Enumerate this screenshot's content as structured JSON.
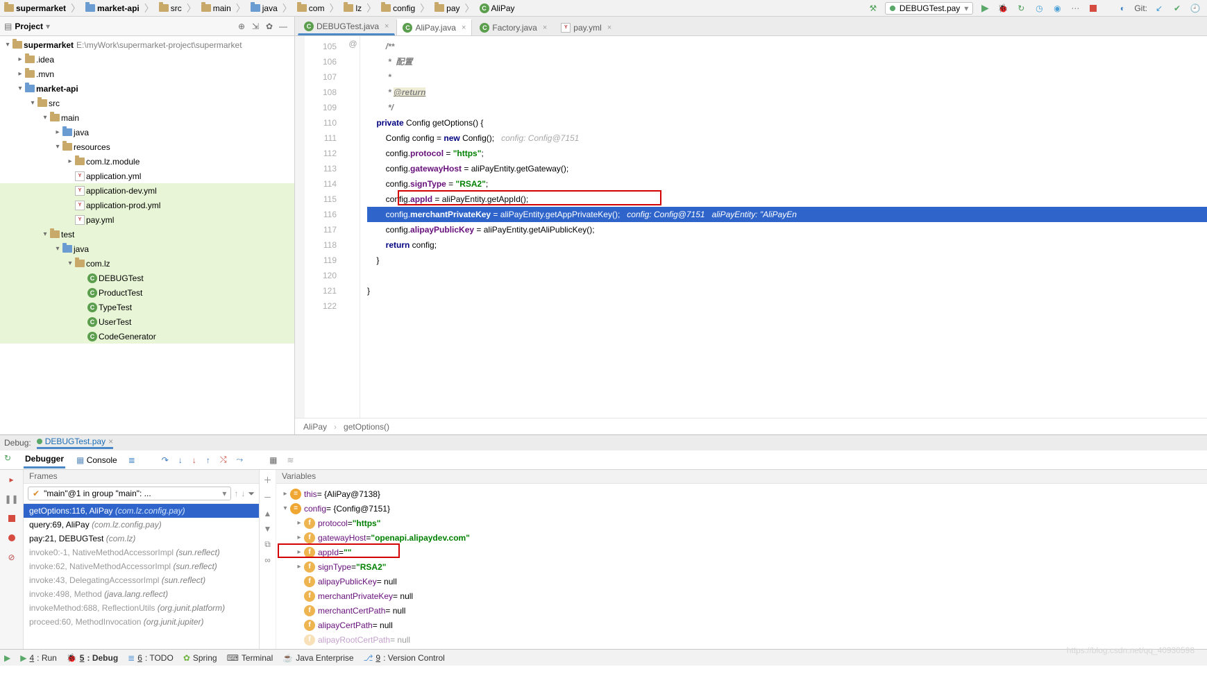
{
  "breadcrumb": [
    "supermarket",
    "market-api",
    "src",
    "main",
    "java",
    "com",
    "lz",
    "config",
    "pay",
    "AliPay"
  ],
  "runConfig": "DEBUGTest.pay",
  "gitLabel": "Git:",
  "project": {
    "title": "Project",
    "root": {
      "name": "supermarket",
      "path": "E:\\myWork\\supermarket-project\\supermarket"
    },
    "nodes": [
      {
        "d": 1,
        "t": "folder",
        "open": true,
        "bold": true,
        "label": "supermarket",
        "suffix": " E:\\myWork\\supermarket-project\\supermarket"
      },
      {
        "d": 2,
        "t": "folder",
        "label": ".idea"
      },
      {
        "d": 2,
        "t": "folder",
        "label": ".mvn"
      },
      {
        "d": 2,
        "t": "module",
        "open": true,
        "bold": true,
        "label": "market-api"
      },
      {
        "d": 3,
        "t": "folder",
        "open": true,
        "label": "src"
      },
      {
        "d": 4,
        "t": "folder",
        "open": true,
        "label": "main"
      },
      {
        "d": 5,
        "t": "folder-blue",
        "label": "java"
      },
      {
        "d": 5,
        "t": "folder",
        "open": true,
        "label": "resources"
      },
      {
        "d": 6,
        "t": "folder",
        "label": "com.lz.module"
      },
      {
        "d": 6,
        "t": "yml",
        "label": "application.yml"
      },
      {
        "d": 6,
        "t": "yml",
        "label": "application-dev.yml",
        "hl": true
      },
      {
        "d": 6,
        "t": "yml",
        "label": "application-prod.yml",
        "hl": true
      },
      {
        "d": 6,
        "t": "yml",
        "label": "pay.yml",
        "hl": true
      },
      {
        "d": 4,
        "t": "folder",
        "open": true,
        "label": "test",
        "hl": true
      },
      {
        "d": 5,
        "t": "folder-blue",
        "open": true,
        "label": "java",
        "hl": true
      },
      {
        "d": 6,
        "t": "folder",
        "open": true,
        "label": "com.lz",
        "hl": true
      },
      {
        "d": 7,
        "t": "class",
        "label": "DEBUGTest",
        "hl": true
      },
      {
        "d": 7,
        "t": "class",
        "label": "ProductTest",
        "hl": true
      },
      {
        "d": 7,
        "t": "class",
        "label": "TypeTest",
        "hl": true
      },
      {
        "d": 7,
        "t": "class",
        "label": "UserTest",
        "hl": true
      },
      {
        "d": 7,
        "t": "class",
        "label": "CodeGenerator",
        "hl": true
      }
    ]
  },
  "tabs": [
    {
      "label": "DEBUGTest.java",
      "icon": "class",
      "focus": true
    },
    {
      "label": "AliPay.java",
      "icon": "class",
      "active": true
    },
    {
      "label": "Factory.java",
      "icon": "class"
    },
    {
      "label": "pay.yml",
      "icon": "yml"
    }
  ],
  "code": {
    "startLine": 105,
    "lines": [
      "/**",
      " *  配置",
      " *",
      " * @return",
      " */",
      "private Config getOptions() {",
      "    Config config = new Config();   config: Config@7151",
      "    config.protocol = \"https\";",
      "    config.gatewayHost = aliPayEntity.getGateway();",
      "    config.signType = \"RSA2\";",
      "    config.appId = aliPayEntity.getAppId();",
      "    config.merchantPrivateKey = aliPayEntity.getAppPrivateKey();   config: Config@7151   aliPayEntity: \"AliPayEn",
      "    config.alipayPublicKey = aliPayEntity.getAliPublicKey();",
      "    return config;",
      "}",
      "",
      "}",
      ""
    ],
    "decl_marker_line": 110,
    "exec_line": 116,
    "redbox_line": 115
  },
  "trail": [
    "AliPay",
    "getOptions()"
  ],
  "debug": {
    "header": "Debug:",
    "session": "DEBUGTest.pay",
    "tabs": [
      "Debugger",
      "Console"
    ],
    "thread": "\"main\"@1 in group \"main\": ...",
    "frames_title": "Frames",
    "vars_title": "Variables",
    "frames": [
      {
        "m": "getOptions:116, AliPay",
        "p": "(com.lz.config.pay)",
        "sel": true
      },
      {
        "m": "query:69, AliPay",
        "p": "(com.lz.config.pay)"
      },
      {
        "m": "pay:21, DEBUGTest",
        "p": "(com.lz)"
      },
      {
        "m": "invoke0:-1, NativeMethodAccessorImpl",
        "p": "(sun.reflect)",
        "dim": true
      },
      {
        "m": "invoke:62, NativeMethodAccessorImpl",
        "p": "(sun.reflect)",
        "dim": true
      },
      {
        "m": "invoke:43, DelegatingAccessorImpl",
        "p": "(sun.reflect)",
        "dim": true
      },
      {
        "m": "invoke:498, Method",
        "p": "(java.lang.reflect)",
        "dim": true
      },
      {
        "m": "invokeMethod:688, ReflectionUtils",
        "p": "(org.junit.platform)",
        "dim": true
      },
      {
        "m": "proceed:60, MethodInvocation",
        "p": "(org.junit.jupiter)",
        "dim": true
      }
    ],
    "vars": [
      {
        "d": 0,
        "k": "eq",
        "name": "this",
        "val": " = {AliPay@7138}"
      },
      {
        "d": 0,
        "k": "eq",
        "name": "config",
        "val": " = {Config@7151}",
        "open": true
      },
      {
        "d": 1,
        "k": "f",
        "name": "protocol",
        "val": " = ",
        "str": "\"https\""
      },
      {
        "d": 1,
        "k": "f",
        "name": "gatewayHost",
        "val": " = ",
        "str": "\"openapi.alipaydev.com\""
      },
      {
        "d": 1,
        "k": "f",
        "name": "appId",
        "val": " = ",
        "str": "\"\"",
        "box": true
      },
      {
        "d": 1,
        "k": "f",
        "name": "signType",
        "val": " = ",
        "str": "\"RSA2\""
      },
      {
        "d": 1,
        "k": "f",
        "name": "alipayPublicKey",
        "val": " = null"
      },
      {
        "d": 1,
        "k": "f",
        "name": "merchantPrivateKey",
        "val": " = null"
      },
      {
        "d": 1,
        "k": "f",
        "name": "merchantCertPath",
        "val": " = null"
      },
      {
        "d": 1,
        "k": "f",
        "name": "alipayCertPath",
        "val": " = null"
      },
      {
        "d": 1,
        "k": "f",
        "name": "alipayRootCertPath",
        "val": " = null",
        "cut": true
      }
    ]
  },
  "status": [
    {
      "icon": "run",
      "u": "4",
      "label": ": Run"
    },
    {
      "icon": "dbg",
      "u": "5",
      "label": ": Debug",
      "active": true
    },
    {
      "icon": "todo",
      "u": "6",
      "label": ": TODO"
    },
    {
      "icon": "spring",
      "label": "Spring"
    },
    {
      "icon": "term",
      "label": "Terminal"
    },
    {
      "icon": "jee",
      "label": "Java Enterprise"
    },
    {
      "icon": "vcs",
      "u": "9",
      "label": ": Version Control"
    }
  ],
  "watermark": "https://blog.csdn.net/qq_40930598"
}
